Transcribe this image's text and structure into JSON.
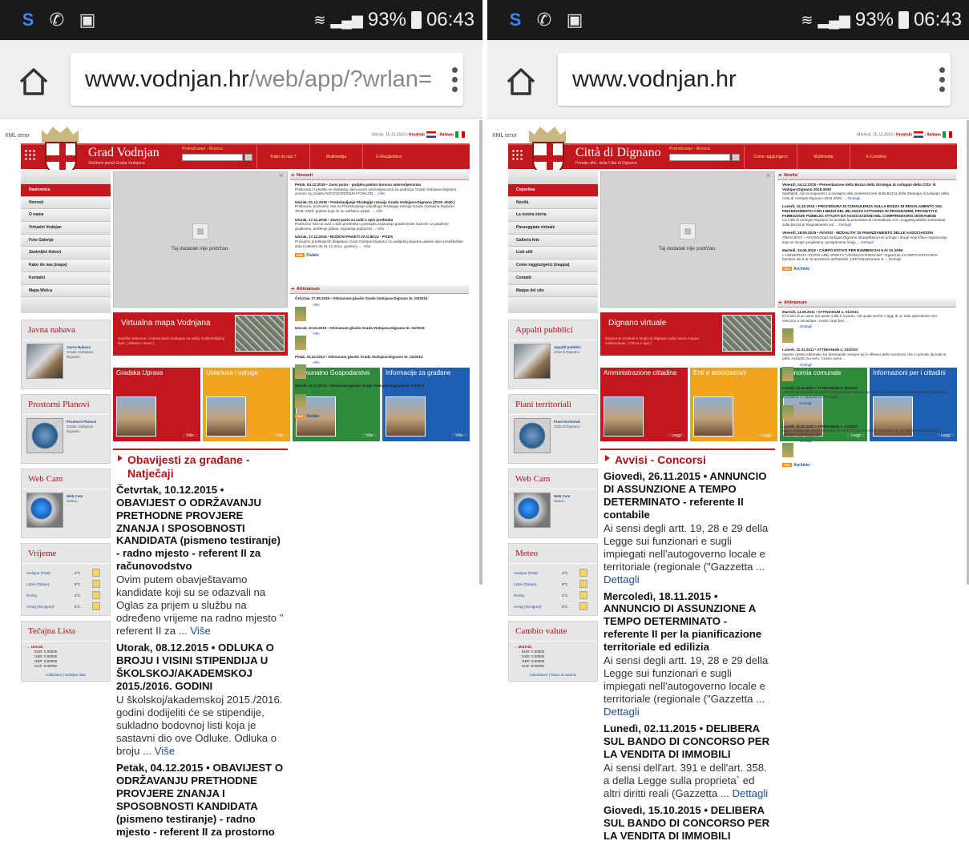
{
  "screens": [
    {
      "status": {
        "time": "06:43",
        "battery": "93%"
      },
      "url": {
        "domain": "www.vodnjan.hr",
        "path": "/web/app/?wrlan="
      },
      "page": {
        "xml_error": "XML error",
        "top_date": "Utorak, 15.12.2015 |",
        "lang1": "Hrvatski",
        "lang2": "Italiano",
        "site_name": "Grad Vodnjan",
        "site_sub": "Službeni portal Grada Vodnjana",
        "search_label": "Pretraživanje - Ricerca:",
        "nav": [
          "Kako do nas ?",
          "Multimedija",
          "E-Razglednice"
        ],
        "menu": [
          "Naslovnica",
          "Novosti",
          "O nama",
          "Virtualni Vodnjan",
          "Foto Galerija",
          "Zanimljivi linkovi",
          "Kako do nas (mapa)",
          "Kontakti",
          "Mapa Web-a"
        ],
        "box1": {
          "title": "Javna nabava",
          "text": "Javna Nabava",
          "sub": "Grada Vodnjana-Dignano"
        },
        "box2": {
          "title": "Prostorni Planovi",
          "text": "Prostorni Planovi",
          "sub": "Grada Vodnjana-Dignano"
        },
        "box3": {
          "title": "Web Cam",
          "text": "Web Cam",
          "sub": "Status:"
        },
        "weather": {
          "title": "Vrijeme",
          "rows": [
            {
              "city": "Vodnjan (Pula):",
              "temp": "4°C"
            },
            {
              "city": "Labin (Rabac):",
              "temp": "9°C"
            },
            {
              "city": "Rovinj:",
              "temp": "4°C"
            },
            {
              "city": "Umag (Novigrad):",
              "temp": "6°C"
            }
          ]
        },
        "rates": {
          "title": "Tečajna Lista",
          "day": "→ Utorak,",
          "lines": [
            "EUR: 0.00000",
            "USD: 0.00000",
            "GBP: 0.00000",
            "CHF: 0.00000"
          ],
          "links": "Kalkulator | Detaljna lista"
        },
        "plugin": "Taj dodatak nije podržan.",
        "virtual": {
          "title": "Virtualna mapa Vodnjana",
          "desc": "Istražite ustanove i znamenitosti Vodnjana na našoj multimedijalnoj karti. [ Kliknite i otvori ]"
        },
        "tiles": [
          {
            "title": "Gradska Uprava",
            "more": ":: Više ::",
            "color": "#c3171d"
          },
          {
            "title": "Ustanove i udruge",
            "more": ":: Više ::",
            "color": "#f0a41c"
          },
          {
            "title": "Komunalno Gospodarstvo",
            "more": ":: Više ::",
            "color": "#2f8a3b"
          },
          {
            "title": "Informacije za građane",
            "more": ":: Više ::",
            "color": "#1f5fb1"
          }
        ],
        "news_title": "Novosti",
        "news": [
          {
            "head": "Petak, 04.12.2015 • Javni poziv - podjela poklon bonova umirovljenicima",
            "body": "Poštovani,U privitku se dostavlja Javni poziv umirovljenicima sa područja Grada Vodnjana-Dignano vezano za podjelu NOVOGODIŠNJIH POKLON ...",
            "more": "Više"
          },
          {
            "head": "Utorak, 01.12.2015 • Predstavljanje Strategije razvoja Grada Vodnjana-Dignano (2015.-2020.)",
            "body": "Poštovani, pozivamo Vas na Predstavljanje prijedloga Strategije razvoja Grada Vodnjana-Dignano 2015.-2020. godine koje će se održati u petak, ...",
            "more": "Više"
          },
          {
            "head": "Utorak, 17.11.2015 • Javni poziv za uvid u spis predmeta",
            "body": "Pozivamo Vas na uvid u spis predmeta u postupku izdavanja građevinske dozvole za građenje građevine, uređenje platoa, izgradnja potpornih ...",
            "more": "Više"
          },
          {
            "head": "Utorak, 17.11.2015 • BOŽIĆNI PAKETI ZA DJECU - POZIV",
            "body": "Povodom predstojećih blagdana, Grad Vodnjan-Dignano će podijeliti prigodne pakete djeci predškolske dobi (rođenim do 31.12.2014. godine) i ...",
            "more": "Više"
          }
        ],
        "ostalo": "Ostalo",
        "att_title": "Attinianum",
        "att": [
          {
            "head": "Četvrtak, 27.08.2015 • Attinianum-glasilo Grada Vodnjana-Dignano br. 02/2015",
            "more": "Više"
          },
          {
            "head": "Utorak, 10.02.2015 • Attinianum-glasilo Grada Vodnjana-Dignano br. 01/2015",
            "more": "Više"
          },
          {
            "head": "Petak, 03.10.2014 • Attinianum-glasilo Grada Vodnjana-Dignano br. 02/2014",
            "more": "Više"
          },
          {
            "head": "Utorak, 11.03.2014 • Attinianum-glasilo Grada Vodnjana-Dignano br. 01/2014",
            "more": "Više"
          }
        ],
        "att_more": "Ostalo",
        "obv_title": "Obavijesti za građane - Natječaji",
        "obv": [
          {
            "head": "Četvrtak, 10.12.2015 • OBAVIJEST O ODRŽAVANJU PRETHODNE PROVJERE ZNANJA I SPOSOBNOSTI KANDIDATA (pismeno testiranje) - radno mjesto - referent II za računovodstvo",
            "body": "Ovim putem obavještavamo kandidate koji su se odazvali na Oglas za prijem u službu na određeno vrijeme na radno mjesto \" referent II za ...",
            "more": "Više"
          },
          {
            "head": "Utorak, 08.12.2015 • ODLUKA O BROJU I VISINI STIPENDIJA U ŠKOLSKOJ/AKADEMSKOJ 2015./2016. GODINI",
            "body": "U školskoj/akademskoj 2015./2016. godini dodijeliti će se stipendije, sukladno bodovnoj listi koja je sastavni dio ove Odluke. Odluka o broju ...",
            "more": "Više"
          },
          {
            "head": "Petak, 04.12.2015 • OBAVIJEST O ODRŽAVANJU PRETHODNE PROVJERE ZNANJA I SPOSOBNOSTI KANDIDATA (pismeno testiranje) - radno mjesto - referent II za prostorno",
            "body": "",
            "more": ""
          }
        ]
      }
    },
    {
      "status": {
        "time": "06:43",
        "battery": "93%"
      },
      "url": {
        "domain": "www.vodnjan.hr",
        "path": ""
      },
      "page": {
        "xml_error": "XML error",
        "top_date": "Martedì, 15.12.2015 |",
        "lang1": "Hrvatski",
        "lang2": "Italiano",
        "site_name": "Città di Dignano",
        "site_sub": "Portale uffic. della Città di Dignano",
        "search_label": "Pretraživanje - Ricerca:",
        "nav": [
          "Come raggiungerci",
          "Multimedia",
          "E-Cartoline"
        ],
        "menu": [
          "Copertina",
          "Novità",
          "La nostra storia",
          "Passeggiata virtuale",
          "Galleria foto",
          "Link utili",
          "Come raggiungerci (mappa)",
          "Contatti",
          "Mappa del sito"
        ],
        "box1": {
          "title": "Appalti pubblici",
          "text": "Appalti pubblici",
          "sub": "Città di Dignano"
        },
        "box2": {
          "title": "Piani territoriali",
          "text": "Piani territoriali",
          "sub": "Città di Dignano"
        },
        "box3": {
          "title": "Web Cam",
          "text": "Web Cam",
          "sub": "Status:"
        },
        "weather": {
          "title": "Meteo",
          "rows": [
            {
              "city": "Vodnjan (Pula):",
              "temp": "4°C"
            },
            {
              "city": "Labin (Rabac):",
              "temp": "9°C"
            },
            {
              "city": "Rovinj:",
              "temp": "4°C"
            },
            {
              "city": "Umag (Novigrad):",
              "temp": "6°C"
            }
          ]
        },
        "rates": {
          "title": "Cambio valute",
          "day": "→ Martedì,",
          "lines": [
            "EUR: 0.00000",
            "USD: 0.00000",
            "GBP: 0.00000",
            "CHF: 0.00000"
          ],
          "links": "Calcolatore | Tasso di cambio"
        },
        "plugin": "Taj dodatak nije podržan.",
        "virtual": {
          "title": "Dignano virtuale",
          "desc": "Esplora le strutture e luoghi di Dignano sulla nostra mappa multimediale. [ Clicca e apri ]"
        },
        "tiles": [
          {
            "title": "Amministrazione cittadina",
            "more": ":: Leggi ::",
            "color": "#c3171d"
          },
          {
            "title": "Enti e associazioni",
            "more": ":: Leggi ::",
            "color": "#f0a41c"
          },
          {
            "title": "Economia comunale",
            "more": ":: Leggi ::",
            "color": "#2f8a3b"
          },
          {
            "title": "Informazioni per i cittadini",
            "more": ":: Leggi ::",
            "color": "#1f5fb1"
          }
        ],
        "news_title": "Novita`",
        "news": [
          {
            "head": "Venerdì, 04.12.2015 • Presentazione della Bozza della Strategia di sviluppo della Citta' di Vodnjan-Dignano 2015-2020",
            "body": "Spettabili, con la seguente La invitiamo alla presentazione della Bozza della Strategia di sviluppo della Città di Vodnjan-Dignano 2015-2020, ...",
            "more": "Dettagli"
          },
          {
            "head": "Lunedì, 12.10.2015 • PROCEDURA DI CONSULENZA SULLA BOZZA DI REGOLAMENTO SUL FINANZIAMENTO CON I MEZZI DEL BILANCIO CITTADINO DI PROGRAMMI, PROGETTI E FABBISOGNI PUBBLICI ATTUATI DA ASSOCIAZIONI DEL COMPRENSORIO DIGNANESE",
            "body": "La Città di Vodnjan-Dignano ha avviato la procedura di consulenza con i soggetti pubblici interessati, sulla Bozza di Regolamento sul ...",
            "more": "Dettagli"
          },
          {
            "head": "Venerdì, 18.09.2015 • AVVISO - MODALITA' DI FINANZIAMENTO DELLE ASSOCIAZIONI",
            "body": "OBAVIJEST – AVVISOGrad Vodnjan-Dignano obavještava sve udruge i druge neprofitne organizacije koje se svojim projektima i programima imaju ...",
            "more": "Dettagli"
          },
          {
            "head": "Martedì, 16.06.2015 • CAMPO ESTIVO PER BAMBINI DAI 6 AI 10 ANNI",
            "body": "L'UNIVERSITA' POPOLARE APERTA \"VODNJAN-DIGNANO\" organizza il CAMPO ESTIVOPer bambini dai 6 ai 10 anniInizio dell'attività: 13/07/2015Durata: 5 ...",
            "more": "Dettagli"
          }
        ],
        "ostalo": "Archivio",
        "att_title": "Attinianum",
        "att": [
          {
            "head": "Martedì, 14.06.2011 • ATTINIANUM n. 01/2011",
            "body": "È l'inizio di un anno nel quale nulla è a posto, nel quale anche i raggi di un sole splendente non riescono a riscaldare i nostri corpi ben ...",
            "more": "Dettagli"
          },
          {
            "head": "Lunedì, 31.01.2011 • ATTINIANUM n. 03/2010",
            "body": "Questo nostro editoriale sta diventando sempre più il riflesso dello sconforto che ci prende da tutte le parti. Assurdo ma vero, l'uomo viene ...",
            "more": "Dettagli"
          },
          {
            "head": "Lunedì, 31.01.2011 • ATTINIANUM n. 02/2010",
            "body": "„Ad occidente nulla di nuovo\" proposizione spesso ripetuta come intercalare parlando del rapporto tra socialismo e capitalismo. In realtà, ...",
            "more": "Dettagli"
          },
          {
            "head": "Lunedì, 31.01.2011 • ATTINIANUM n. 01/2010",
            "body": "Siamo entrati nel primo trimestre del 2010 e non c'è niente di buono: da un lato la natura lunatica, dall'altro una situazione ...",
            "more": "Dettagli"
          }
        ],
        "att_more": "Archivio",
        "obv_title": "Avvisi - Concorsi",
        "obv": [
          {
            "head": "Giovedì, 26.11.2015 • ANNUNCIO DI ASSUNZIONE A TEMPO DETERMINATO - referente II contabile",
            "body": "Ai sensi degli artt. 19, 28 e 29 della Legge sui funzionari e sugli impiegati nell'autogoverno locale e territoriale (regionale (\"Gazzetta ...",
            "more": "Dettagli"
          },
          {
            "head": "Mercoledì, 18.11.2015 • ANNUNCIO DI ASSUNZIONE A TEMPO DETERMINATO - referente II per la pianificazione territoriale ed edilizia",
            "body": "Ai sensi degli artt. 19, 28 e 29 della Legge sui funzionari e sugli impiegati nell'autogoverno locale e territoriale (regionale (\"Gazzetta ...",
            "more": "Dettagli"
          },
          {
            "head": "Lunedì, 02.11.2015 • DELIBERA SUL BANDO DI CONCORSO PER LA VENDITA DI IMMOBILI",
            "body": "Ai sensi dell'art. 391 e dell'art. 358. a della Legge sulla proprieta` ed altri diritti reali (Gazzetta ...",
            "more": "Dettagli"
          },
          {
            "head": "Giovedì, 15.10.2015 • DELIBERA SUL BANDO DI CONCORSO PER LA VENDITA DI IMMOBILI",
            "body": "",
            "more": ""
          }
        ]
      }
    }
  ]
}
